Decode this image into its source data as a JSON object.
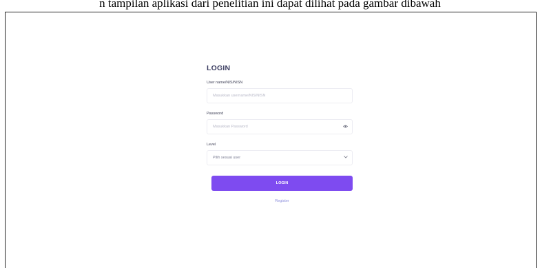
{
  "caption": "n tampilan aplikasi dari penelitian ini dapat dilihat pada gambar dibawah",
  "login": {
    "title": "LOGIN",
    "username": {
      "label": "User name/NIS/NISN",
      "placeholder": "Masukkan username/NIS/NISN"
    },
    "password": {
      "label": "Password",
      "placeholder": "Masukkan Password",
      "icon": "eye-icon"
    },
    "level": {
      "label": "Level",
      "selected": "Pilih sesuai user",
      "icon": "chevron-down-icon"
    },
    "button_label": "LOGIN",
    "register_label": "Register",
    "accent_color": "#7e4bf0"
  }
}
